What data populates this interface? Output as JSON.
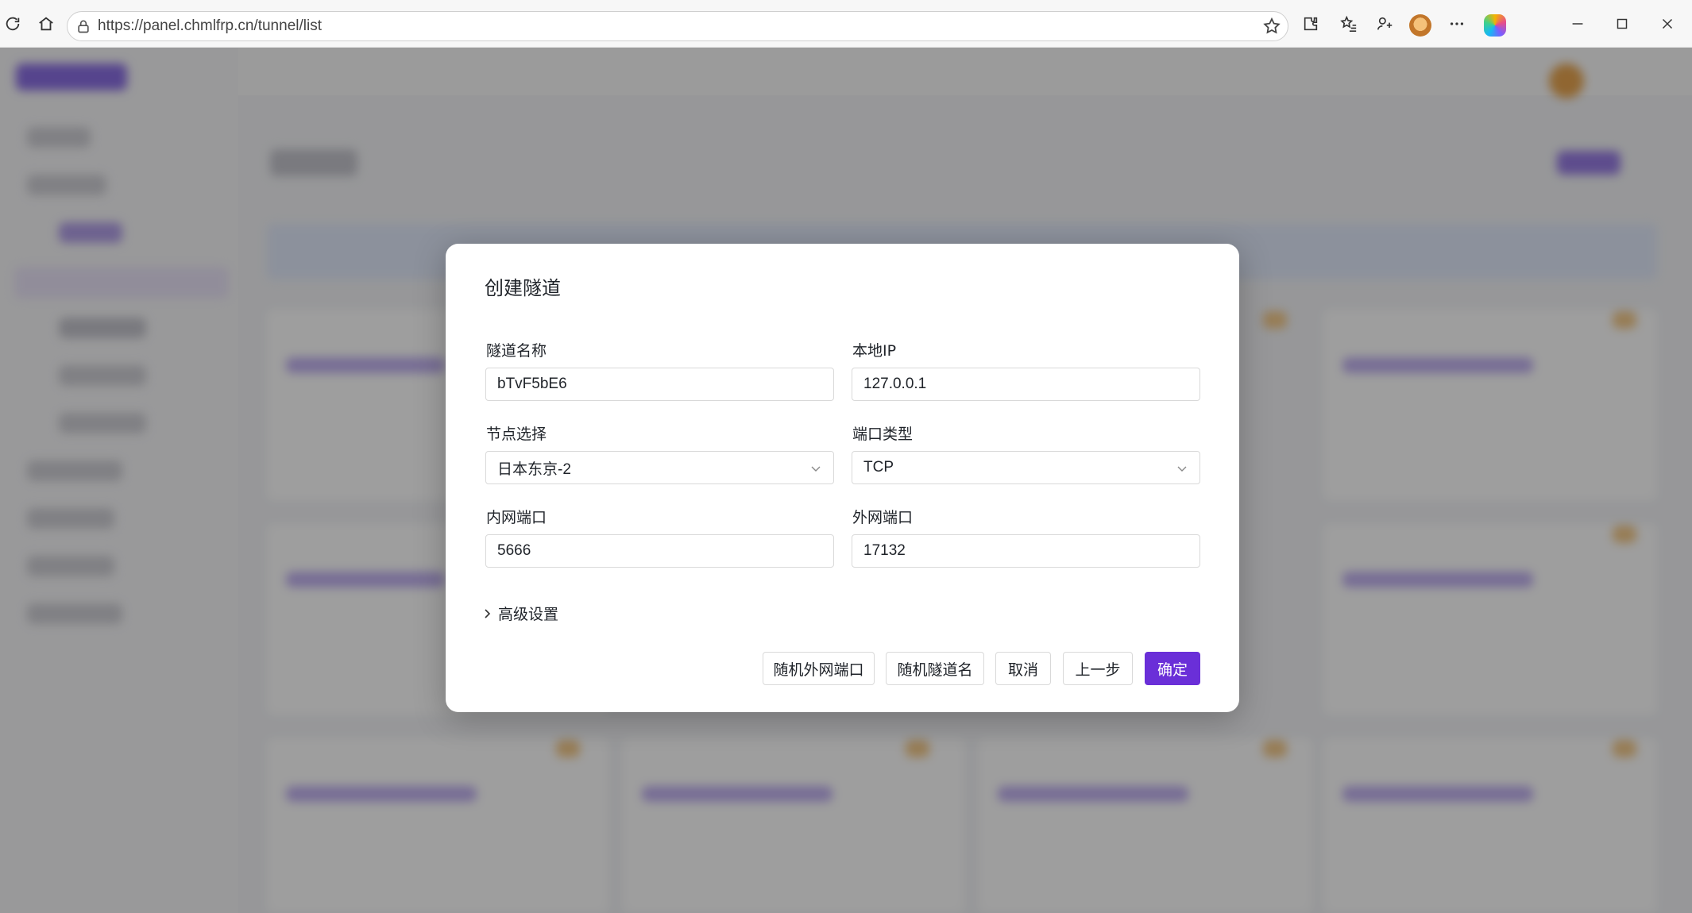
{
  "browser": {
    "url": "https://panel.chmlfrp.cn/tunnel/list"
  },
  "dialog": {
    "title": "创建隧道",
    "fields": {
      "tunnel_name": {
        "label": "隧道名称",
        "value": "bTvF5bE6"
      },
      "local_ip": {
        "label": "本地IP",
        "value": "127.0.0.1"
      },
      "node": {
        "label": "节点选择",
        "value": "日本东京-2"
      },
      "port_type": {
        "label": "端口类型",
        "value": "TCP"
      },
      "internal_port": {
        "label": "内网端口",
        "value": "5666"
      },
      "external_port": {
        "label": "外网端口",
        "value": "17132"
      }
    },
    "advanced_label": "高级设置",
    "buttons": {
      "random_port": "随机外网端口",
      "random_name": "随机隧道名",
      "cancel": "取消",
      "prev": "上一步",
      "confirm": "确定"
    }
  },
  "colors": {
    "primary": "#6a2fd8",
    "overlay": "rgba(40,40,40,0.45)"
  }
}
